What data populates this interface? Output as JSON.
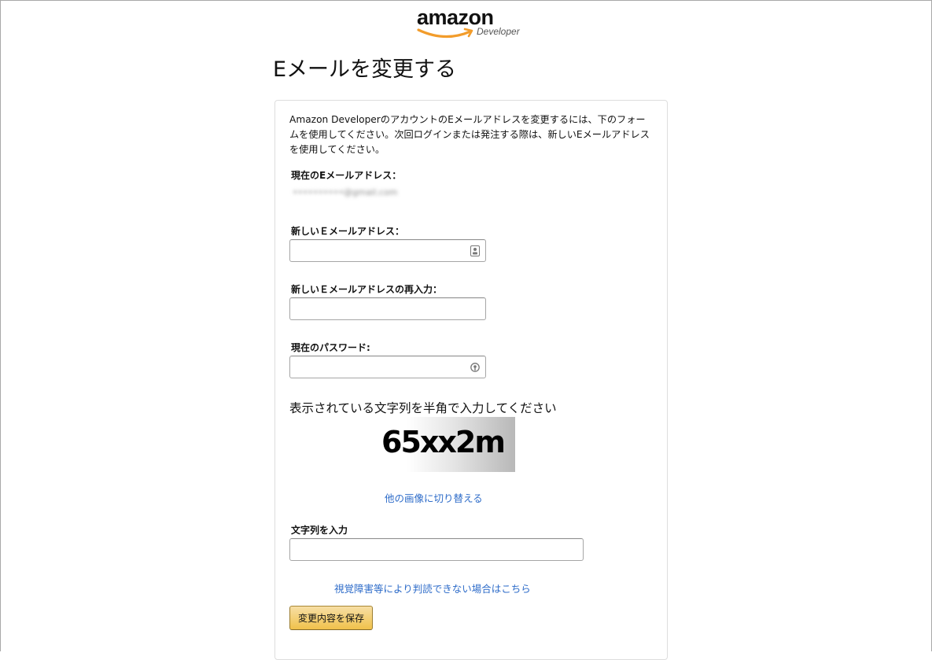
{
  "logo": {
    "word": "amazon",
    "sub": "Developer",
    "smile_color": "#f29c2b"
  },
  "page": {
    "title": "Eメールを変更する"
  },
  "form": {
    "intro": "Amazon DeveloperのアカウントのEメールアドレスを変更するには、下のフォームを使用してください。次回ログインまたは発注する際は、新しいEメールアドレスを使用してください。",
    "current_email_label": "現在のEメールアドレス：",
    "current_email_value": "••••••••••@gmail.com",
    "new_email_label": "新しいＥメールアドレス：",
    "new_email_value": "",
    "confirm_email_label": "新しいＥメールアドレスの再入力：",
    "confirm_email_value": "",
    "password_label": "現在のパスワード:",
    "password_value": "",
    "captcha_prompt": "表示されている文字列を半角で入力してください",
    "captcha_text": "65xx2m",
    "switch_image_link": "他の画像に切り替える",
    "captcha_input_label": "文字列を入力",
    "captcha_input_value": "",
    "accessibility_link": "視覚障害等により判読できない場合はこちら",
    "save_button": "変更内容を保存"
  },
  "colors": {
    "link": "#2e6cc9",
    "button_top": "#f7dfa5",
    "button_bottom": "#f0c14b"
  },
  "icons": {
    "new_email_field_icon": "contact-card-icon",
    "password_field_icon": "password-key-icon"
  }
}
